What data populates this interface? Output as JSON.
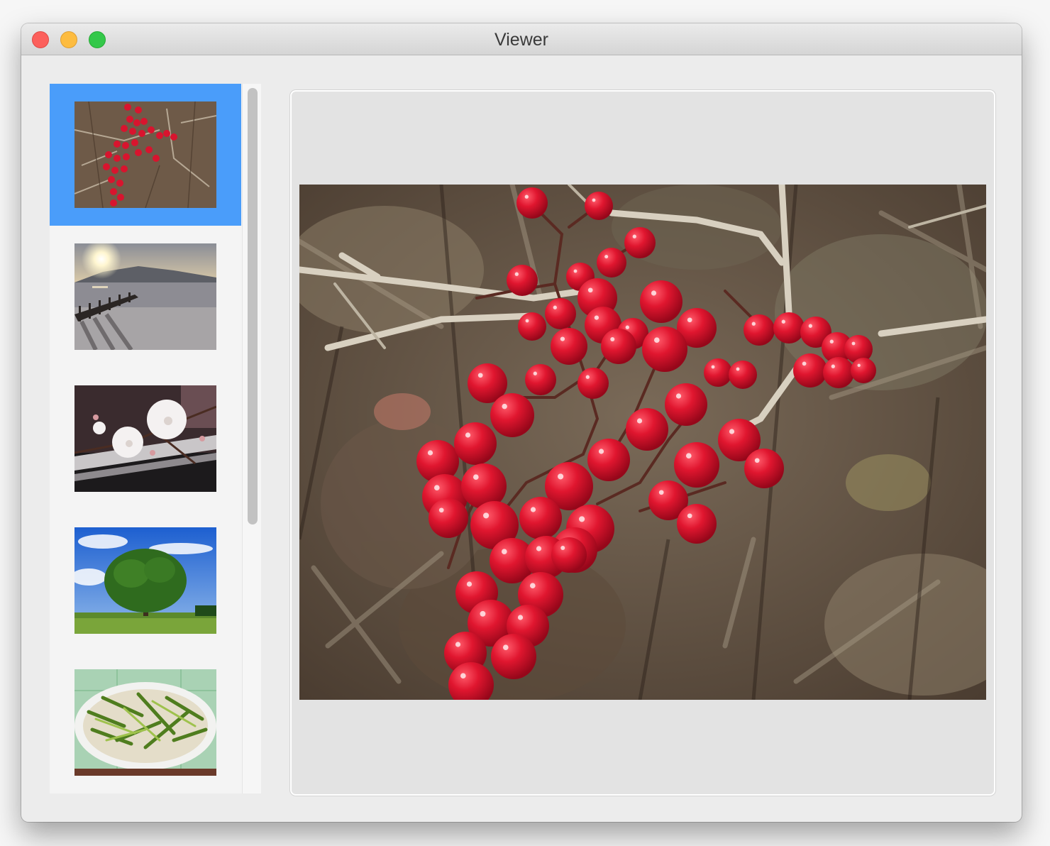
{
  "window": {
    "title": "Viewer"
  },
  "thumbnails": [
    {
      "icon": "red-berries-image",
      "selected": true
    },
    {
      "icon": "sunset-lake-pier-image",
      "selected": false
    },
    {
      "icon": "white-blossoms-image",
      "selected": false
    },
    {
      "icon": "green-tree-field-image",
      "selected": false
    },
    {
      "icon": "vegetable-plate-image",
      "selected": false
    }
  ],
  "viewer": {
    "icon": "red-berries-image"
  },
  "colors": {
    "selection": "#4a9dfa",
    "berry": "#d8142e",
    "close": "#fc605c",
    "minimize": "#fdbc40",
    "maximize": "#34c84a"
  }
}
